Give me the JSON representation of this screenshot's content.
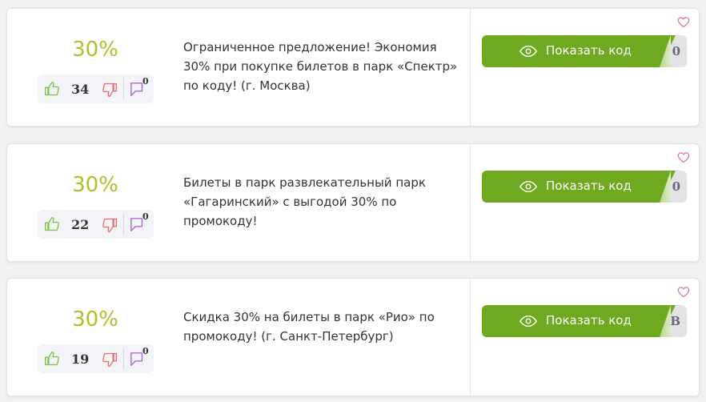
{
  "coupons": [
    {
      "discount": "30%",
      "likes": "34",
      "comments": "0",
      "description": "Ограниченное предложение! Экономия 30% при покупке билетов в парк «Спектр» по коду! (г. Москва)",
      "button_label": "Показать код",
      "code_peek": "0"
    },
    {
      "discount": "30%",
      "likes": "22",
      "comments": "0",
      "description": "Билеты в парк развлекательный парк «Гагаринский» с выгодой 30% по промокоду!",
      "button_label": "Показать код",
      "code_peek": "0"
    },
    {
      "discount": "30%",
      "likes": "19",
      "comments": "0",
      "description": "Скидка 30% на билеты в парк «Рио» по промокоду! (г. Санкт-Петербург)",
      "button_label": "Показать код",
      "code_peek": "B"
    }
  ],
  "icons": {
    "like": "thumb-up-icon",
    "dislike": "thumb-down-icon",
    "comment": "comment-icon",
    "favorite": "heart-icon",
    "show": "eye-icon"
  },
  "colors": {
    "discount": "#a6c52a",
    "button": "#6ea91f",
    "like": "#7bc043",
    "dislike": "#e06c6c",
    "comment": "#b06ad0",
    "favorite": "#e06c85"
  }
}
